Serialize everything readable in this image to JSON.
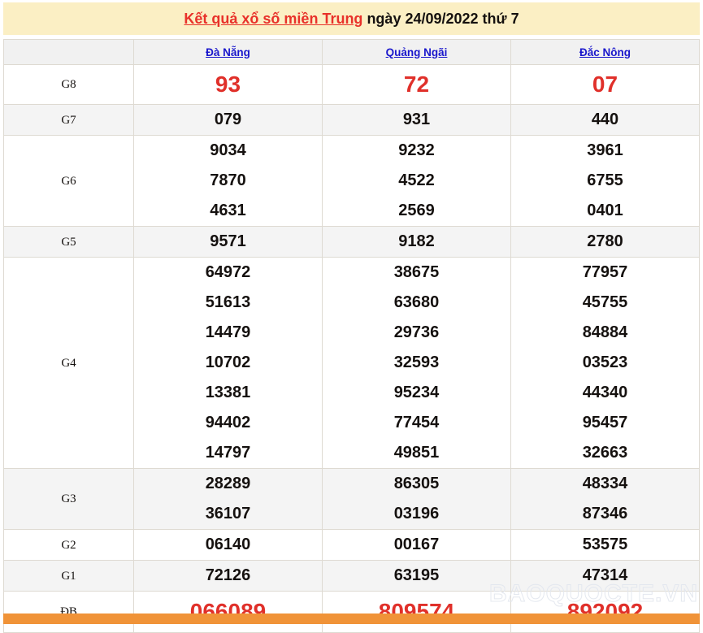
{
  "header": {
    "title_red": "Kết quả xổ số miền Trung",
    "title_black": " ngày 24/09/2022 thứ 7",
    "banner_color": "#fbefc4",
    "red_color": "#e8312a"
  },
  "table": {
    "corner_label": "",
    "provinces": [
      "Đà Nẵng",
      "Quảng Ngãi",
      "Đắc Nông"
    ],
    "rows": [
      {
        "label": "G8",
        "highlight": true,
        "values": {
          "da_nang": "93",
          "quang_ngai": "72",
          "dac_nong": "07"
        }
      },
      {
        "label": "G7",
        "highlight": false,
        "values": {
          "da_nang": "079",
          "quang_ngai": "931",
          "dac_nong": "440"
        }
      },
      {
        "label": "G6",
        "highlight": false,
        "values": {
          "da_nang": "9034\n7870\n4631",
          "quang_ngai": "9232\n4522\n2569",
          "dac_nong": "3961\n6755\n0401"
        }
      },
      {
        "label": "G5",
        "highlight": false,
        "values": {
          "da_nang": "9571",
          "quang_ngai": "9182",
          "dac_nong": "2780"
        }
      },
      {
        "label": "G4",
        "highlight": false,
        "values": {
          "da_nang": "64972\n51613\n14479\n10702\n13381\n94402\n14797",
          "quang_ngai": "38675\n63680\n29736\n32593\n95234\n77454\n49851",
          "dac_nong": "77957\n45755\n84884\n03523\n44340\n95457\n32663"
        }
      },
      {
        "label": "G3",
        "highlight": false,
        "values": {
          "da_nang": "28289\n36107",
          "quang_ngai": "86305\n03196",
          "dac_nong": "48334\n87346"
        }
      },
      {
        "label": "G2",
        "highlight": false,
        "values": {
          "da_nang": "06140",
          "quang_ngai": "00167",
          "dac_nong": "53575"
        }
      },
      {
        "label": "G1",
        "highlight": false,
        "values": {
          "da_nang": "72126",
          "quang_ngai": "63195",
          "dac_nong": "47314"
        }
      },
      {
        "label": "ĐB",
        "highlight": true,
        "values": {
          "da_nang": "066089",
          "quang_ngai": "809574",
          "dac_nong": "892092"
        }
      }
    ]
  },
  "watermark": {
    "text": "BAOQUOCTE.VN"
  },
  "footer": {
    "bar_color": "#f09338"
  }
}
